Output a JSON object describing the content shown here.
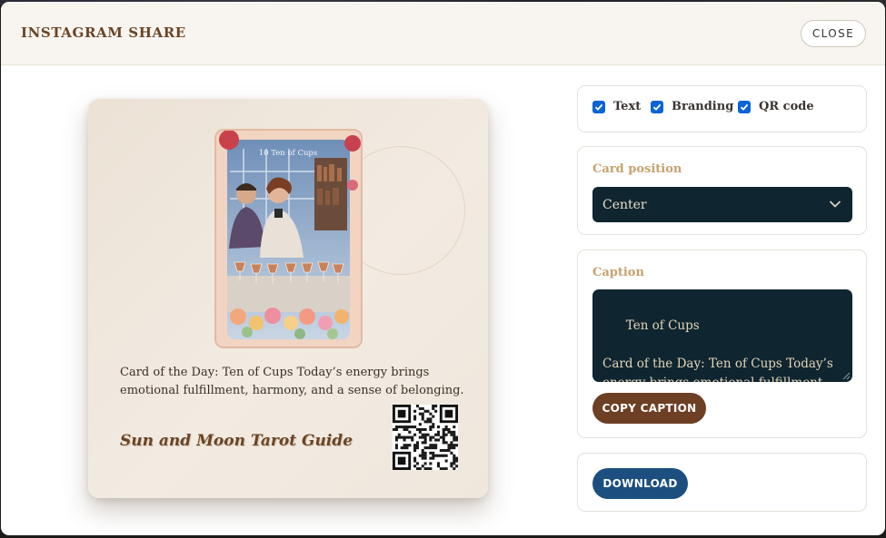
{
  "modal": {
    "title": "INSTAGRAM SHARE",
    "close_label": "CLOSE"
  },
  "preview": {
    "card_title": "10 Ten of Cups",
    "caption": "Card of the Day: Ten of Cups Today’s energy brings emotional fulfillment, harmony, and a sense of belonging.",
    "branding": "Sun and Moon Tarot Guide"
  },
  "options": {
    "text": {
      "label": "Text",
      "checked": true
    },
    "branding": {
      "label": "Branding",
      "checked": true
    },
    "qr_code": {
      "label": "QR code",
      "checked": true
    }
  },
  "card_position": {
    "label": "Card position",
    "selected": "Center"
  },
  "caption": {
    "label": "Caption",
    "value": "Ten of Cups\n\nCard of the Day: Ten of Cups Today’s energy brings emotional fulfillment, harmony, and a sense of belonging. The",
    "copy_label": "COPY CAPTION"
  },
  "download_label": "DOWNLOAD",
  "colors": {
    "brand_brown": "#6b4424",
    "dark_field": "#0f2530",
    "gold_label": "#c6a26e",
    "checkbox_blue": "#0b63d6",
    "download_blue": "#1c4f80",
    "copy_brown": "#6d3f24"
  }
}
